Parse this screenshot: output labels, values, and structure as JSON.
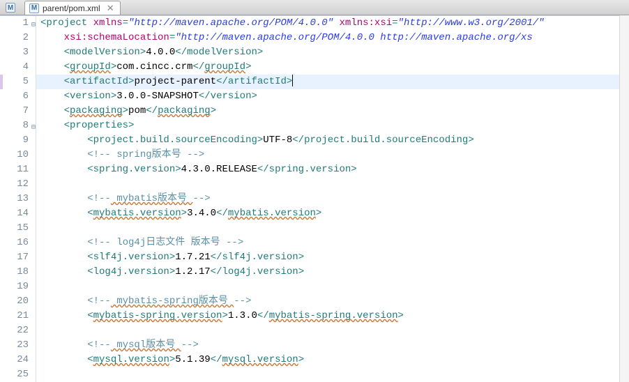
{
  "tab": {
    "icon_letter": "M",
    "title": "parent/pom.xml",
    "close_glyph": "✕"
  },
  "outer_icon_letter": "M",
  "current_line_index": 5,
  "lines": [
    {
      "n": 1,
      "indent": 0,
      "kind": "tag-open-attrs",
      "tag": "project",
      "attrs": [
        [
          "xmlns",
          "http://maven.apache.org/POM/4.0.0"
        ],
        [
          "xmlns:xsi",
          "http://www.w3.org/2001/"
        ]
      ],
      "foldable": true
    },
    {
      "n": 2,
      "indent": 2,
      "kind": "attr-continue",
      "attrs": [
        [
          "xsi:schemaLocation",
          "http://maven.apache.org/POM/4.0.0 http://maven.apache.org/xs"
        ]
      ]
    },
    {
      "n": 3,
      "indent": 2,
      "kind": "elem",
      "tag": "modelVersion",
      "text": "4.0.0"
    },
    {
      "n": 4,
      "indent": 2,
      "kind": "elem",
      "tag": "groupId",
      "text": "com.cincc.crm",
      "err": true
    },
    {
      "n": 5,
      "indent": 2,
      "kind": "elem",
      "tag": "artifactId",
      "text": "project-parent",
      "cursor_after_close": true
    },
    {
      "n": 6,
      "indent": 2,
      "kind": "elem",
      "tag": "version",
      "text": "3.0.0-SNAPSHOT"
    },
    {
      "n": 7,
      "indent": 2,
      "kind": "elem",
      "tag": "packaging",
      "text": "pom",
      "err": true
    },
    {
      "n": 8,
      "indent": 2,
      "kind": "open",
      "tag": "properties",
      "foldable": true
    },
    {
      "n": 9,
      "indent": 4,
      "kind": "elem",
      "tag": "project.build.sourceEncoding",
      "text": "UTF-8"
    },
    {
      "n": 10,
      "indent": 4,
      "kind": "comment",
      "text": " spring版本号 "
    },
    {
      "n": 11,
      "indent": 4,
      "kind": "elem",
      "tag": "spring.version",
      "text": "4.3.0.RELEASE"
    },
    {
      "n": 12,
      "indent": 4,
      "kind": "blank"
    },
    {
      "n": 13,
      "indent": 4,
      "kind": "comment",
      "text": " mybatis版本号 ",
      "err": true
    },
    {
      "n": 14,
      "indent": 4,
      "kind": "elem",
      "tag": "mybatis.version",
      "text": "3.4.0",
      "err": true
    },
    {
      "n": 15,
      "indent": 4,
      "kind": "blank"
    },
    {
      "n": 16,
      "indent": 4,
      "kind": "comment",
      "text": " log4j日志文件 版本号 "
    },
    {
      "n": 17,
      "indent": 4,
      "kind": "elem",
      "tag": "slf4j.version",
      "text": "1.7.21"
    },
    {
      "n": 18,
      "indent": 4,
      "kind": "elem",
      "tag": "log4j.version",
      "text": "1.2.17"
    },
    {
      "n": 19,
      "indent": 4,
      "kind": "blank"
    },
    {
      "n": 20,
      "indent": 4,
      "kind": "comment",
      "text": " mybatis-spring版本号 ",
      "err": true
    },
    {
      "n": 21,
      "indent": 4,
      "kind": "elem",
      "tag": "mybatis-spring.version",
      "text": "1.3.0",
      "err": true
    },
    {
      "n": 22,
      "indent": 4,
      "kind": "blank"
    },
    {
      "n": 23,
      "indent": 4,
      "kind": "comment",
      "text": " mysql版本号 ",
      "err": true
    },
    {
      "n": 24,
      "indent": 4,
      "kind": "elem",
      "tag": "mysql.version",
      "text": "5.1.39",
      "err": true
    },
    {
      "n": 25,
      "indent": 4,
      "kind": "blank"
    }
  ]
}
